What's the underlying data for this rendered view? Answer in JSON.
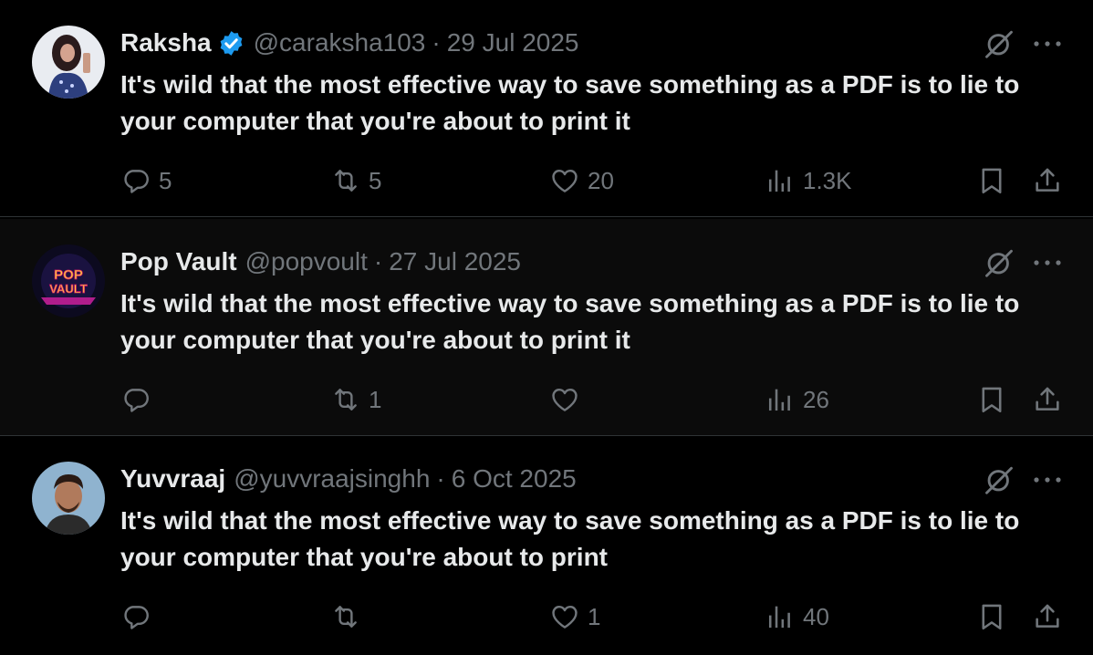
{
  "colors": {
    "background": "#000000",
    "text": "#e7e9ea",
    "muted": "#71767b",
    "verified": "#1d9bf0",
    "divider": "#2f3336"
  },
  "separator": "·",
  "icons": {
    "reply": "reply-icon",
    "retweet": "retweet-icon",
    "like": "heart-icon",
    "views": "views-icon",
    "bookmark": "bookmark-icon",
    "share": "share-icon",
    "grok": "grok-icon",
    "more": "more-icon",
    "verified": "verified-badge-icon"
  },
  "tweets": [
    {
      "name": "Raksha",
      "verified": true,
      "handle": "@caraksha103",
      "date": "29 Jul 2025",
      "text": "It's wild that the most effective way to save something as a PDF is to lie to your computer that you're about to print it",
      "replies": "5",
      "retweets": "5",
      "likes": "20",
      "views": "1.3K"
    },
    {
      "name": "Pop Vault",
      "verified": false,
      "handle": "@popvoult",
      "date": "27 Jul 2025",
      "avatar_text": "POP VAULT",
      "text": "It's wild that the most effective way to save something as a PDF is to lie to your computer that you're about to print it",
      "replies": "",
      "retweets": "1",
      "likes": "",
      "views": "26"
    },
    {
      "name": "Yuvvraaj",
      "verified": false,
      "handle": "@yuvvraajsinghh",
      "date": "6 Oct 2025",
      "text": "It's wild that the most effective way to save something as a PDF is to lie to your computer that you're about to print",
      "replies": "",
      "retweets": "",
      "likes": "1",
      "views": "40"
    }
  ]
}
